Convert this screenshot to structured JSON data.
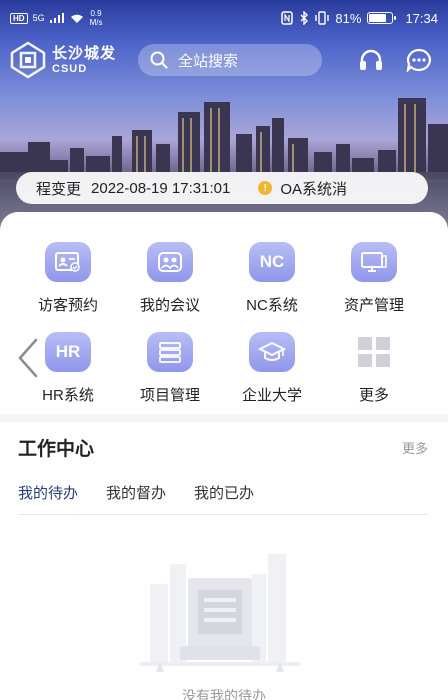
{
  "status_bar": {
    "hd1": "HD",
    "net": "5G",
    "speed_value": "0.9",
    "speed_unit": "M/s",
    "battery": "81%",
    "battery_level": 0.81,
    "time": "17:34"
  },
  "header": {
    "logo_cn": "长沙城发",
    "logo_en": "CSUD",
    "search_placeholder": "全站搜索"
  },
  "notice": {
    "title": "程变更",
    "datetime": "2022-08-19 17:31:01",
    "badge": "!",
    "source": "OA系统消"
  },
  "apps": [
    {
      "label": "访客预约",
      "icon": "visitor-card-icon"
    },
    {
      "label": "我的会议",
      "icon": "meeting-icon"
    },
    {
      "label": "NC系统",
      "icon": "nc-text-icon",
      "icon_text": "NC"
    },
    {
      "label": "资产管理",
      "icon": "monitor-icon"
    },
    {
      "label": "HR系统",
      "icon": "hr-text-icon",
      "icon_text": "HR"
    },
    {
      "label": "项目管理",
      "icon": "server-stack-icon"
    },
    {
      "label": "企业大学",
      "icon": "graduation-cap-icon"
    },
    {
      "label": "更多",
      "icon": "grid-icon"
    }
  ],
  "work_center": {
    "title": "工作中心",
    "more": "更多",
    "tabs": [
      "我的待办",
      "我的督办",
      "我的已办"
    ],
    "active_tab": 0,
    "empty_text": "没有我的待办"
  },
  "colors": {
    "accent": "#2a3f7a",
    "icon_bg": "#9aa1ee",
    "badge": "#f2b533"
  }
}
